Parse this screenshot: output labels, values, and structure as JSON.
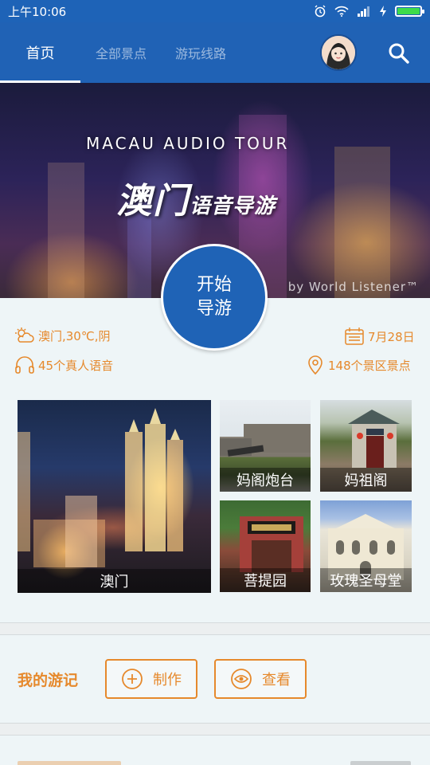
{
  "status_bar": {
    "time": "上午10:06"
  },
  "nav": {
    "tabs": [
      {
        "label": "首页",
        "active": true
      },
      {
        "label": "全部景点",
        "active": false
      },
      {
        "label": "游玩线路",
        "active": false
      }
    ],
    "avatar_icon": "user-avatar",
    "search_icon": "search-icon"
  },
  "banner": {
    "subtitle": "MACAU AUDIO TOUR",
    "title_main": "澳门",
    "title_tail": "语音导游",
    "credit": "by World Listener™"
  },
  "start_button": {
    "line1": "开始",
    "line2": "导游"
  },
  "info": {
    "weather": "澳门,30℃,阴",
    "date": "7月28日",
    "voices": "45个真人语音",
    "spots": "148个景区景点"
  },
  "attractions": [
    {
      "label": "澳门"
    },
    {
      "label": "妈阁炮台"
    },
    {
      "label": "妈祖阁"
    },
    {
      "label": "菩提园"
    },
    {
      "label": "玫瑰圣母堂"
    }
  ],
  "diary": {
    "title": "我的游记",
    "create_label": "制作",
    "view_label": "查看"
  },
  "colors": {
    "primary": "#2062b5",
    "accent": "#e6892c",
    "card_bg": "#eef5f7"
  }
}
